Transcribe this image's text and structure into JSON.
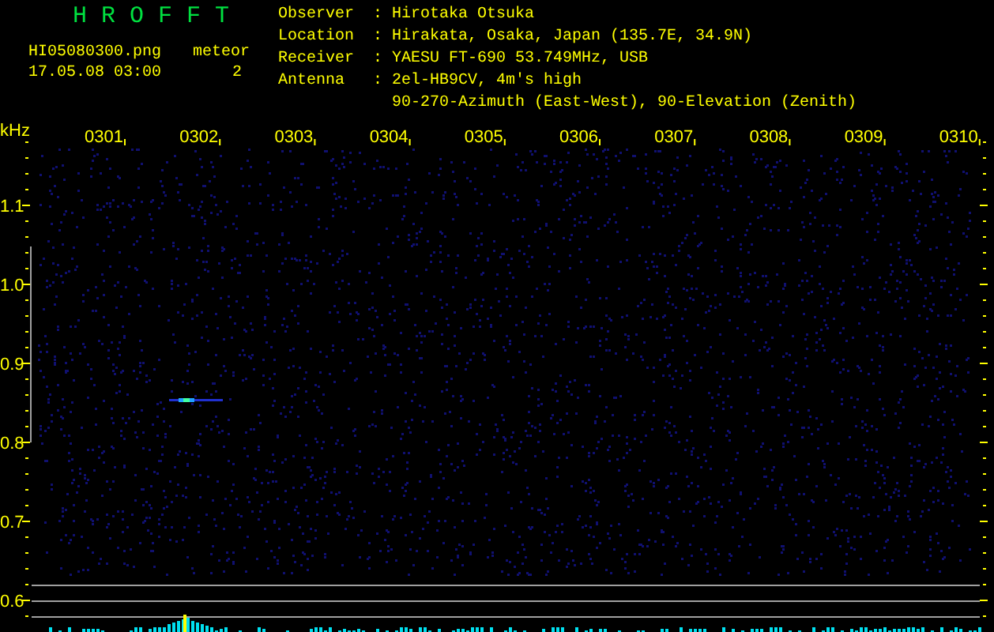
{
  "header": {
    "title": "H R O F F T",
    "filename": "HI05080300.png",
    "timestamp": "17.05.08 03:00",
    "meteor_label": "meteor",
    "meteor_count": "2"
  },
  "station_info": [
    {
      "label": "Observer",
      "separator": ":",
      "values": [
        "Hirotaka Otsuka"
      ]
    },
    {
      "label": "Location",
      "separator": ":",
      "values": [
        "Hirakata, Osaka, Japan (135.7E, 34.9N)"
      ]
    },
    {
      "label": "Receiver",
      "separator": ":",
      "values": [
        "YAESU FT-690 53.749MHz, USB"
      ]
    },
    {
      "label": "Antenna",
      "separator": ":",
      "values": [
        "2el-HB9CV, 4m's high",
        "90-270-Azimuth (East-West), 90-Elevation (Zenith)"
      ]
    }
  ],
  "spectrogram": {
    "y_unit": "kHz",
    "y_labels": [
      "1.1",
      "1.0",
      "0.9",
      "0.8",
      "0.7",
      "0.6"
    ],
    "x_labels": [
      "0301",
      "0302",
      "0303",
      "0304",
      "0305",
      "0306",
      "0307",
      "0308",
      "0309",
      "0310"
    ]
  }
}
